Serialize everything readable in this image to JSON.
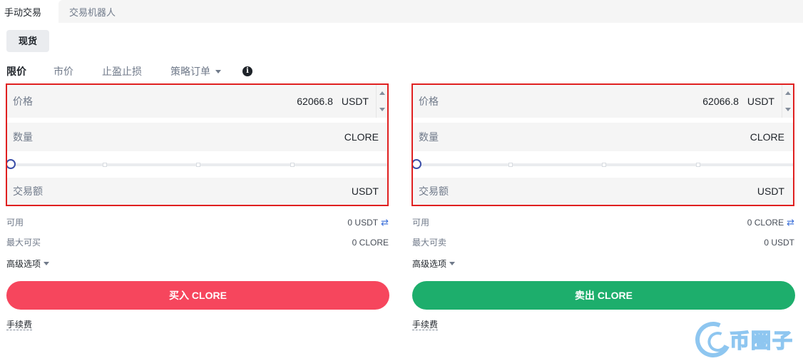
{
  "top_tabs": {
    "manual": "手动交易",
    "bot": "交易机器人"
  },
  "spot_label": "现货",
  "order_tabs": {
    "limit": "限价",
    "market": "市价",
    "tp_sl": "止盈止损",
    "strategy": "策略订单"
  },
  "buy": {
    "price_label": "价格",
    "price_value": "62066.8",
    "price_unit": "USDT",
    "qty_label": "数量",
    "qty_unit": "CLORE",
    "total_label": "交易额",
    "total_unit": "USDT",
    "slider_percent": 0,
    "available_label": "可用",
    "available_value": "0 USDT",
    "max_label": "最大可买",
    "max_value": "0 CLORE",
    "advanced_label": "高级选项",
    "button_label": "买入 CLORE",
    "fee_label": "手续费"
  },
  "sell": {
    "price_label": "价格",
    "price_value": "62066.8",
    "price_unit": "USDT",
    "qty_label": "数量",
    "qty_unit": "CLORE",
    "total_label": "交易额",
    "total_unit": "USDT",
    "slider_percent": 0,
    "available_label": "可用",
    "available_value": "0 CLORE",
    "max_label": "最大可卖",
    "max_value": "0 USDT",
    "advanced_label": "高级选项",
    "button_label": "卖出 CLORE",
    "fee_label": "手续费"
  },
  "icons": {
    "info": "info-icon",
    "swap": "swap-arrows-icon",
    "caret": "caret-down-icon"
  },
  "colors": {
    "buy": "#f6465d",
    "sell": "#1dae6c",
    "highlight": "#e02020",
    "slider": "#3b4fa8"
  },
  "watermark": "币圈子"
}
